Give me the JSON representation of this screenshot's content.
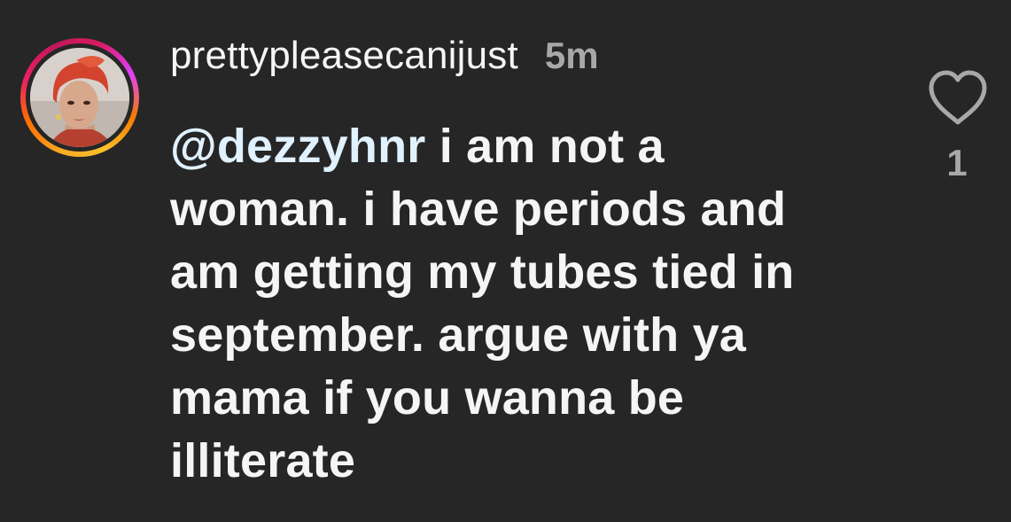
{
  "comment": {
    "username": "prettypleasecanijust",
    "timestamp": "5m",
    "mention": "@dezzyhnr",
    "text": " i am not a woman. i have periods and am getting my tubes tied in september. argue with ya mama if you wanna be illiterate",
    "like_count": "1"
  },
  "icons": {
    "like": "heart-outline-icon"
  },
  "colors": {
    "background": "#262626",
    "text": "#f5f5f5",
    "secondary_text": "#a8a8a8",
    "mention": "#e0f1ff",
    "story_ring_start": "#f9a825",
    "story_ring_end": "#d81b60"
  }
}
